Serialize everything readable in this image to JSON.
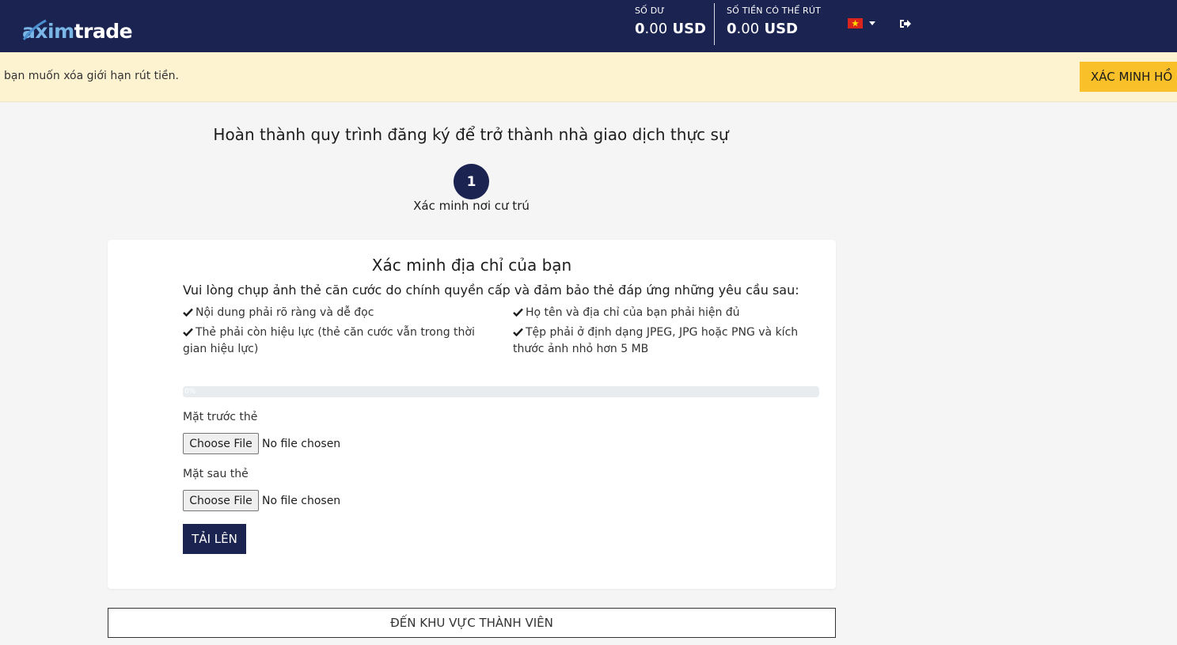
{
  "header": {
    "logo": {
      "prefix": "axim",
      "suffix": "trade"
    },
    "balance": {
      "label": "SỐ DƯ",
      "amount_whole": "0",
      "amount_cents": ".00",
      "currency": "USD"
    },
    "withdrawable": {
      "label": "SỐ TIỀN CÓ THỂ RÚT",
      "amount_whole": "0",
      "amount_cents": ".00",
      "currency": "USD"
    },
    "language_flag": "vietnam-flag-icon",
    "logout_icon": "logout-icon",
    "colors": {
      "navy": "#1b2351",
      "accent": "#f9c02a",
      "alert_bg": "#fdf3d1"
    }
  },
  "alert": {
    "text": "bạn muốn xóa giới hạn rút tiền.",
    "button": "XÁC MINH HỒ"
  },
  "main": {
    "title": "Hoàn thành quy trình đăng ký để trở thành nhà giao dịch thực sự",
    "step": {
      "number": "1",
      "label": "Xác minh nơi cư trú"
    }
  },
  "card": {
    "title": "Xác minh địa chỉ của bạn",
    "subtitle": "Vui lòng chụp ảnh thẻ căn cước do chính quyền cấp và đảm bảo thẻ đáp ứng những yêu cầu sau:",
    "requirements": [
      "Nội dung phải rõ ràng và dễ đọc",
      "Họ tên và địa chỉ của bạn phải hiện đủ",
      "Thẻ phải còn hiệu lực (thẻ căn cước vẫn trong thời gian hiệu lực)",
      "Tệp phải ở định dạng JPEG, JPG hoặc PNG và kích thước ảnh nhỏ hơn 5 MB"
    ],
    "progress": {
      "text": "0%",
      "value": 0
    },
    "front": {
      "label": "Mặt trước thẻ",
      "button": "Choose File",
      "status": "No file chosen"
    },
    "back": {
      "label": "Mặt sau thẻ",
      "button": "Choose File",
      "status": "No file chosen"
    },
    "upload_button": "TẢI LÊN"
  },
  "footer_button": "ĐẾN KHU VỰC THÀNH VIÊN"
}
